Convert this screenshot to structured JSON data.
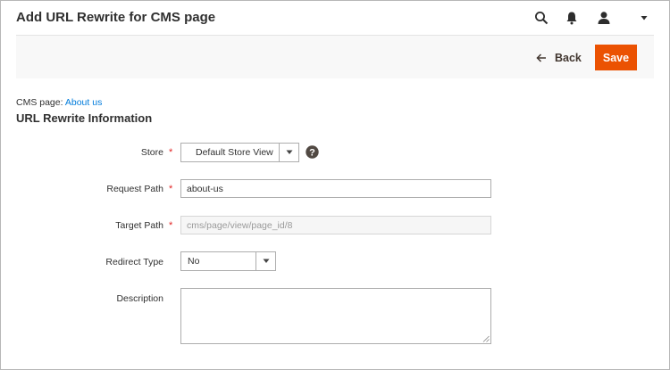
{
  "header": {
    "title": "Add URL Rewrite for CMS page",
    "icons": [
      "search-icon",
      "bell-icon",
      "user-icon",
      "chevron-down-icon"
    ]
  },
  "actions": {
    "back_label": "Back",
    "save_label": "Save"
  },
  "cms_page": {
    "prefix": "CMS page:",
    "link_label": "About us"
  },
  "section": {
    "title": "URL Rewrite Information"
  },
  "form": {
    "store": {
      "label": "Store",
      "value": "Default Store View",
      "required": "*"
    },
    "request_path": {
      "label": "Request Path",
      "value": "about-us",
      "required": "*"
    },
    "target_path": {
      "label": "Target Path",
      "value": "cms/page/view/page_id/8",
      "required": "*"
    },
    "redirect_type": {
      "label": "Redirect Type",
      "value": "No"
    },
    "description": {
      "label": "Description",
      "value": ""
    }
  },
  "colors": {
    "accent": "#eb5202",
    "link": "#007bdb",
    "required": "#e22626"
  }
}
